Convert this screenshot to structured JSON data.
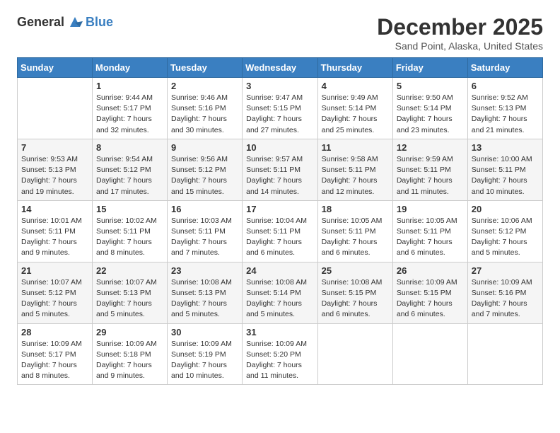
{
  "logo": {
    "general": "General",
    "blue": "Blue"
  },
  "title": "December 2025",
  "subtitle": "Sand Point, Alaska, United States",
  "weekdays": [
    "Sunday",
    "Monday",
    "Tuesday",
    "Wednesday",
    "Thursday",
    "Friday",
    "Saturday"
  ],
  "weeks": [
    [
      {
        "day": "",
        "info": ""
      },
      {
        "day": "1",
        "info": "Sunrise: 9:44 AM\nSunset: 5:17 PM\nDaylight: 7 hours\nand 32 minutes."
      },
      {
        "day": "2",
        "info": "Sunrise: 9:46 AM\nSunset: 5:16 PM\nDaylight: 7 hours\nand 30 minutes."
      },
      {
        "day": "3",
        "info": "Sunrise: 9:47 AM\nSunset: 5:15 PM\nDaylight: 7 hours\nand 27 minutes."
      },
      {
        "day": "4",
        "info": "Sunrise: 9:49 AM\nSunset: 5:14 PM\nDaylight: 7 hours\nand 25 minutes."
      },
      {
        "day": "5",
        "info": "Sunrise: 9:50 AM\nSunset: 5:14 PM\nDaylight: 7 hours\nand 23 minutes."
      },
      {
        "day": "6",
        "info": "Sunrise: 9:52 AM\nSunset: 5:13 PM\nDaylight: 7 hours\nand 21 minutes."
      }
    ],
    [
      {
        "day": "7",
        "info": "Sunrise: 9:53 AM\nSunset: 5:13 PM\nDaylight: 7 hours\nand 19 minutes."
      },
      {
        "day": "8",
        "info": "Sunrise: 9:54 AM\nSunset: 5:12 PM\nDaylight: 7 hours\nand 17 minutes."
      },
      {
        "day": "9",
        "info": "Sunrise: 9:56 AM\nSunset: 5:12 PM\nDaylight: 7 hours\nand 15 minutes."
      },
      {
        "day": "10",
        "info": "Sunrise: 9:57 AM\nSunset: 5:11 PM\nDaylight: 7 hours\nand 14 minutes."
      },
      {
        "day": "11",
        "info": "Sunrise: 9:58 AM\nSunset: 5:11 PM\nDaylight: 7 hours\nand 12 minutes."
      },
      {
        "day": "12",
        "info": "Sunrise: 9:59 AM\nSunset: 5:11 PM\nDaylight: 7 hours\nand 11 minutes."
      },
      {
        "day": "13",
        "info": "Sunrise: 10:00 AM\nSunset: 5:11 PM\nDaylight: 7 hours\nand 10 minutes."
      }
    ],
    [
      {
        "day": "14",
        "info": "Sunrise: 10:01 AM\nSunset: 5:11 PM\nDaylight: 7 hours\nand 9 minutes."
      },
      {
        "day": "15",
        "info": "Sunrise: 10:02 AM\nSunset: 5:11 PM\nDaylight: 7 hours\nand 8 minutes."
      },
      {
        "day": "16",
        "info": "Sunrise: 10:03 AM\nSunset: 5:11 PM\nDaylight: 7 hours\nand 7 minutes."
      },
      {
        "day": "17",
        "info": "Sunrise: 10:04 AM\nSunset: 5:11 PM\nDaylight: 7 hours\nand 6 minutes."
      },
      {
        "day": "18",
        "info": "Sunrise: 10:05 AM\nSunset: 5:11 PM\nDaylight: 7 hours\nand 6 minutes."
      },
      {
        "day": "19",
        "info": "Sunrise: 10:05 AM\nSunset: 5:11 PM\nDaylight: 7 hours\nand 6 minutes."
      },
      {
        "day": "20",
        "info": "Sunrise: 10:06 AM\nSunset: 5:12 PM\nDaylight: 7 hours\nand 5 minutes."
      }
    ],
    [
      {
        "day": "21",
        "info": "Sunrise: 10:07 AM\nSunset: 5:12 PM\nDaylight: 7 hours\nand 5 minutes."
      },
      {
        "day": "22",
        "info": "Sunrise: 10:07 AM\nSunset: 5:13 PM\nDaylight: 7 hours\nand 5 minutes."
      },
      {
        "day": "23",
        "info": "Sunrise: 10:08 AM\nSunset: 5:13 PM\nDaylight: 7 hours\nand 5 minutes."
      },
      {
        "day": "24",
        "info": "Sunrise: 10:08 AM\nSunset: 5:14 PM\nDaylight: 7 hours\nand 5 minutes."
      },
      {
        "day": "25",
        "info": "Sunrise: 10:08 AM\nSunset: 5:15 PM\nDaylight: 7 hours\nand 6 minutes."
      },
      {
        "day": "26",
        "info": "Sunrise: 10:09 AM\nSunset: 5:15 PM\nDaylight: 7 hours\nand 6 minutes."
      },
      {
        "day": "27",
        "info": "Sunrise: 10:09 AM\nSunset: 5:16 PM\nDaylight: 7 hours\nand 7 minutes."
      }
    ],
    [
      {
        "day": "28",
        "info": "Sunrise: 10:09 AM\nSunset: 5:17 PM\nDaylight: 7 hours\nand 8 minutes."
      },
      {
        "day": "29",
        "info": "Sunrise: 10:09 AM\nSunset: 5:18 PM\nDaylight: 7 hours\nand 9 minutes."
      },
      {
        "day": "30",
        "info": "Sunrise: 10:09 AM\nSunset: 5:19 PM\nDaylight: 7 hours\nand 10 minutes."
      },
      {
        "day": "31",
        "info": "Sunrise: 10:09 AM\nSunset: 5:20 PM\nDaylight: 7 hours\nand 11 minutes."
      },
      {
        "day": "",
        "info": ""
      },
      {
        "day": "",
        "info": ""
      },
      {
        "day": "",
        "info": ""
      }
    ]
  ]
}
